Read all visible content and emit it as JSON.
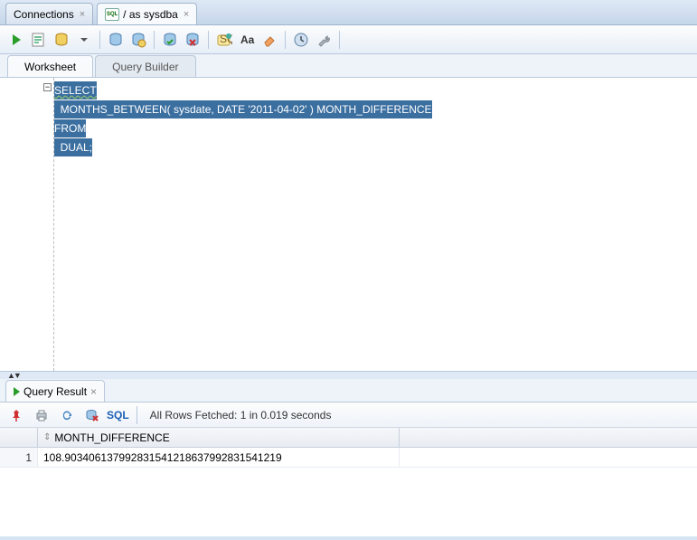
{
  "topTabs": {
    "connections": "Connections",
    "sysdba": "/ as sysdba"
  },
  "contentTabs": {
    "worksheet": "Worksheet",
    "queryBuilder": "Query Builder"
  },
  "sql": {
    "line1a": "SELECT",
    "line2": "  MONTHS_BETWEEN( sysdate, DATE '2011-04-02' ) MONTH_DIFFERENCE",
    "line3": "FROM",
    "line4": "  DUAL;"
  },
  "resultTab": "Query Result",
  "resultToolbar": {
    "sql": "SQL",
    "status": "All Rows Fetched: 1 in 0.019 seconds"
  },
  "grid": {
    "col1": "MONTH_DIFFERENCE",
    "rownum": "1",
    "val1": "108.903406137992831541218637992831541219"
  }
}
